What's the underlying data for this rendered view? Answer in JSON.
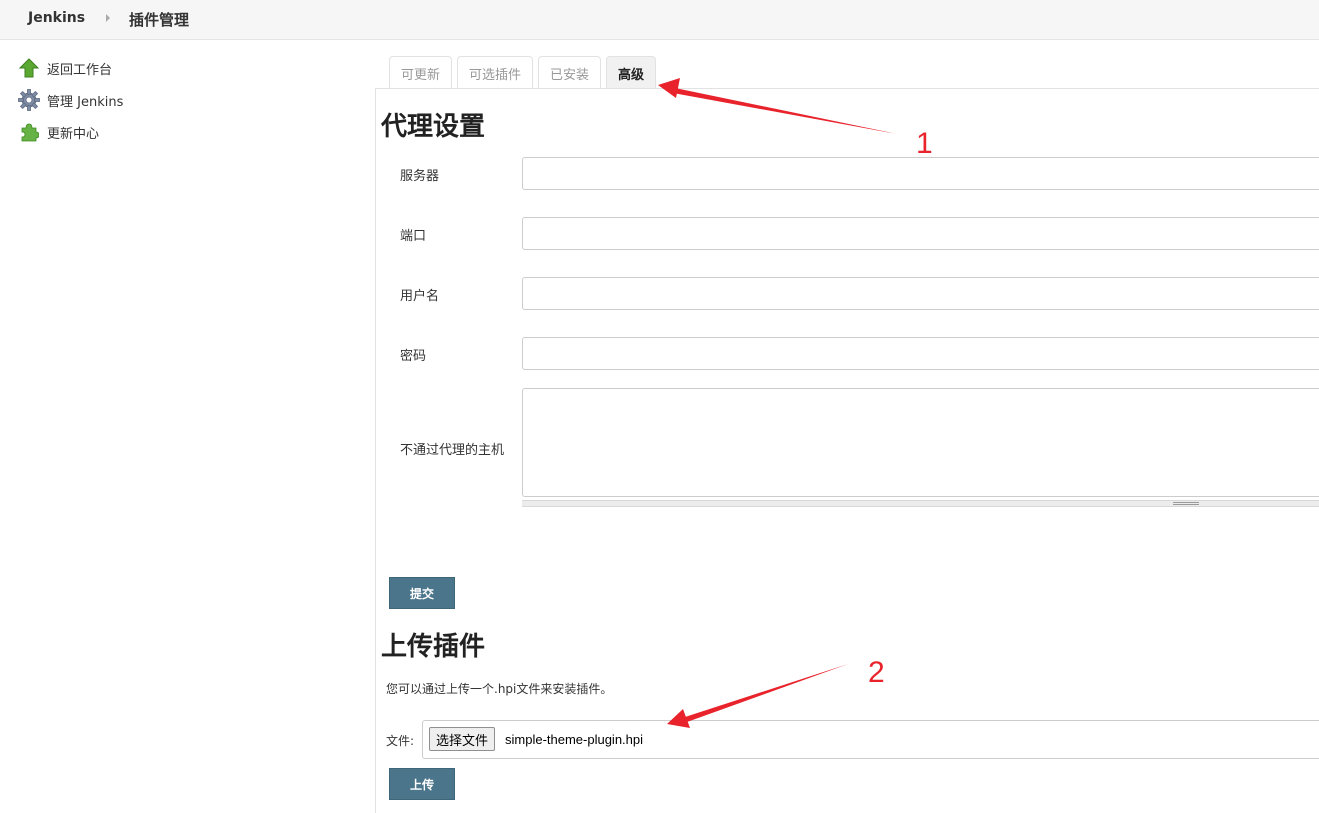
{
  "breadcrumb": {
    "home": "Jenkins",
    "current": "插件管理"
  },
  "sidebar": {
    "items": [
      {
        "label": "返回工作台",
        "icon": "up-arrow-icon"
      },
      {
        "label": "管理 Jenkins",
        "icon": "gear-icon"
      },
      {
        "label": "更新中心",
        "icon": "puzzle-icon"
      }
    ]
  },
  "tabs": [
    {
      "label": "可更新",
      "active": false
    },
    {
      "label": "可选插件",
      "active": false
    },
    {
      "label": "已安装",
      "active": false
    },
    {
      "label": "高级",
      "active": true
    }
  ],
  "proxy": {
    "title": "代理设置",
    "fields": {
      "server": {
        "label": "服务器",
        "value": ""
      },
      "port": {
        "label": "端口",
        "value": ""
      },
      "username": {
        "label": "用户名",
        "value": ""
      },
      "password": {
        "label": "密码",
        "value": ""
      },
      "no_proxy_hosts": {
        "label": "不通过代理的主机",
        "value": ""
      }
    },
    "submit_label": "提交"
  },
  "upload": {
    "title": "上传插件",
    "description": "您可以通过上传一个.hpi文件来安装插件。",
    "file_label": "文件:",
    "choose_button": "选择文件",
    "file_name": "simple-theme-plugin.hpi",
    "upload_label": "上传"
  },
  "annotations": {
    "color": "#e8232b",
    "labels": [
      "1",
      "2"
    ]
  },
  "colors": {
    "button_bg": "#4b758b",
    "active_tab_bg": "#f1f1f1",
    "annotation": "#e8232b"
  }
}
